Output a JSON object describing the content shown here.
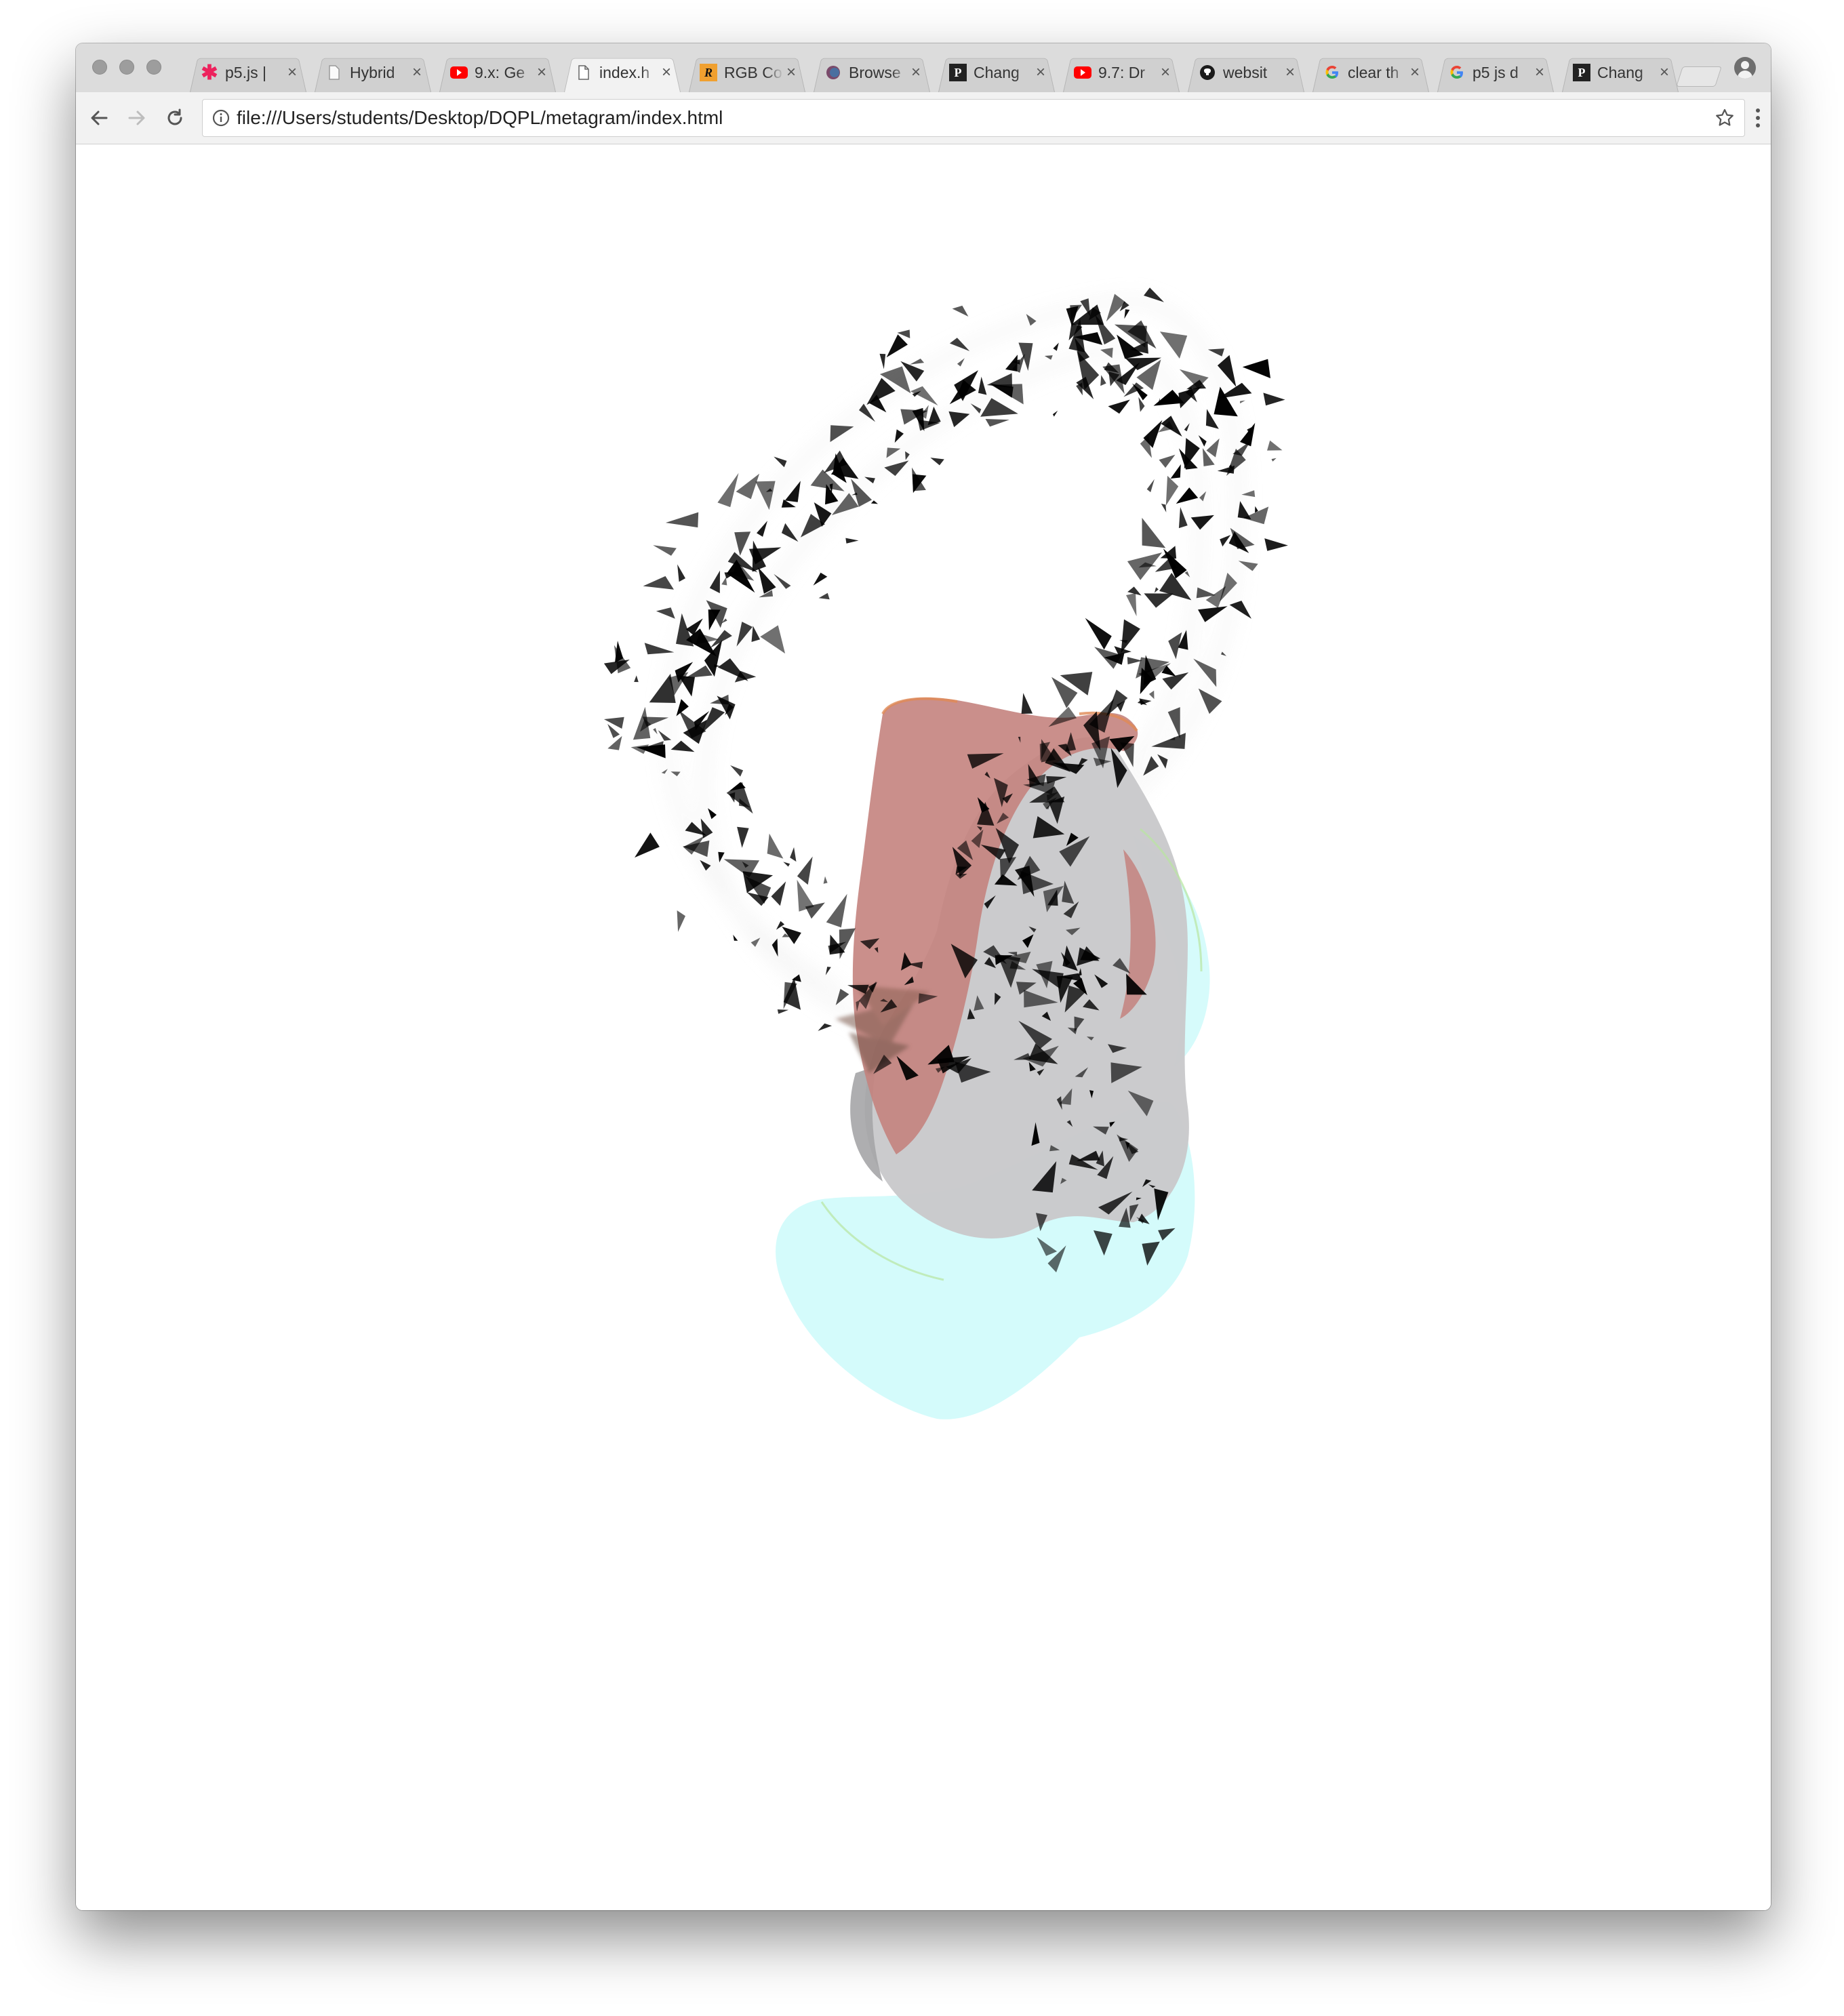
{
  "browser": {
    "tabs": [
      {
        "title": "p5.js |",
        "icon": "p5js-asterisk-icon",
        "active": false
      },
      {
        "title": "Hybrid",
        "icon": "page-icon",
        "active": false
      },
      {
        "title": "9.x: Ge",
        "icon": "youtube-icon",
        "active": false
      },
      {
        "title": "index.h",
        "icon": "document-icon",
        "active": true
      },
      {
        "title": "RGB Co",
        "icon": "r-logo-icon",
        "active": false
      },
      {
        "title": "Browse",
        "icon": "circle-logo-icon",
        "active": false
      },
      {
        "title": "Chang",
        "icon": "p-logo-icon",
        "active": false
      },
      {
        "title": "9.7: Dr",
        "icon": "youtube-icon",
        "active": false
      },
      {
        "title": "websit",
        "icon": "github-icon",
        "active": false
      },
      {
        "title": "clear th",
        "icon": "google-icon",
        "active": false
      },
      {
        "title": "p5 js d",
        "icon": "google-icon",
        "active": false
      },
      {
        "title": "Chang",
        "icon": "p-logo-icon",
        "active": false
      }
    ],
    "close_glyph": "×",
    "address": {
      "url": "file:///Users/students/Desktop/DQPL/metagram/index.html"
    },
    "colors": {
      "chrome_bg": "#dcdcdc",
      "toolbar_bg": "#f2f2f2",
      "youtube_red": "#ff0000",
      "p5_pink": "#ed225d",
      "r_orange": "#f0a030"
    }
  },
  "page": {
    "content": "p5.js sketch canvas with translucent pink, grey and pale cyan blob shapes and a looping trail of small black triangles",
    "colors": {
      "blob_pink": "#c4837e",
      "blob_grey": "#c9c9cb",
      "blob_cyan": "#d2fbfb",
      "particles": "#000000"
    }
  }
}
